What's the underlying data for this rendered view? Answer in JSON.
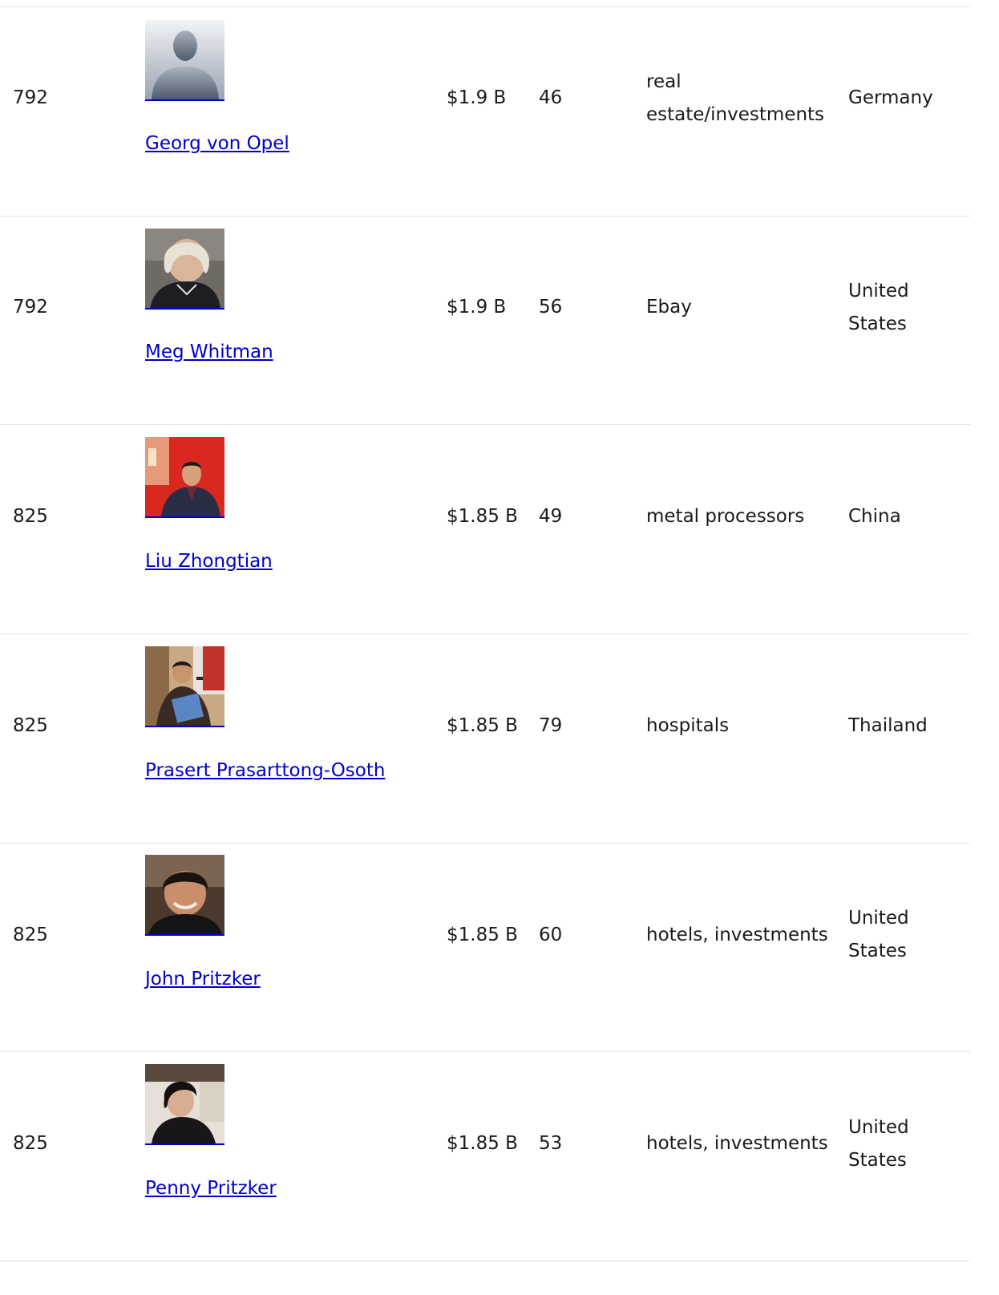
{
  "rows": [
    {
      "rank": "792",
      "name": "Georg von Opel",
      "worth": "$1.9 B",
      "age": "46",
      "source": "real estate/investments",
      "country": "Germany",
      "photo": "silhouette-placeholder"
    },
    {
      "rank": "792",
      "name": "Meg Whitman",
      "worth": "$1.9 B",
      "age": "56",
      "source": "Ebay",
      "country": "United States",
      "photo": "portrait"
    },
    {
      "rank": "825",
      "name": "Liu Zhongtian",
      "worth": "$1.85 B",
      "age": "49",
      "source": "metal processors",
      "country": "China",
      "photo": "portrait"
    },
    {
      "rank": "825",
      "name": "Prasert Prasarttong-Osoth",
      "worth": "$1.85 B",
      "age": "79",
      "source": "hospitals",
      "country": "Thailand",
      "photo": "portrait"
    },
    {
      "rank": "825",
      "name": "John Pritzker",
      "worth": "$1.85 B",
      "age": "60",
      "source": "hotels, investments",
      "country": "United States",
      "photo": "portrait"
    },
    {
      "rank": "825",
      "name": "Penny Pritzker",
      "worth": "$1.85 B",
      "age": "53",
      "source": "hotels, investments",
      "country": "United States",
      "photo": "portrait"
    }
  ],
  "colors": {
    "link": "#0000cc",
    "rule": "#e3e3e3",
    "text": "#1a1a1a"
  }
}
